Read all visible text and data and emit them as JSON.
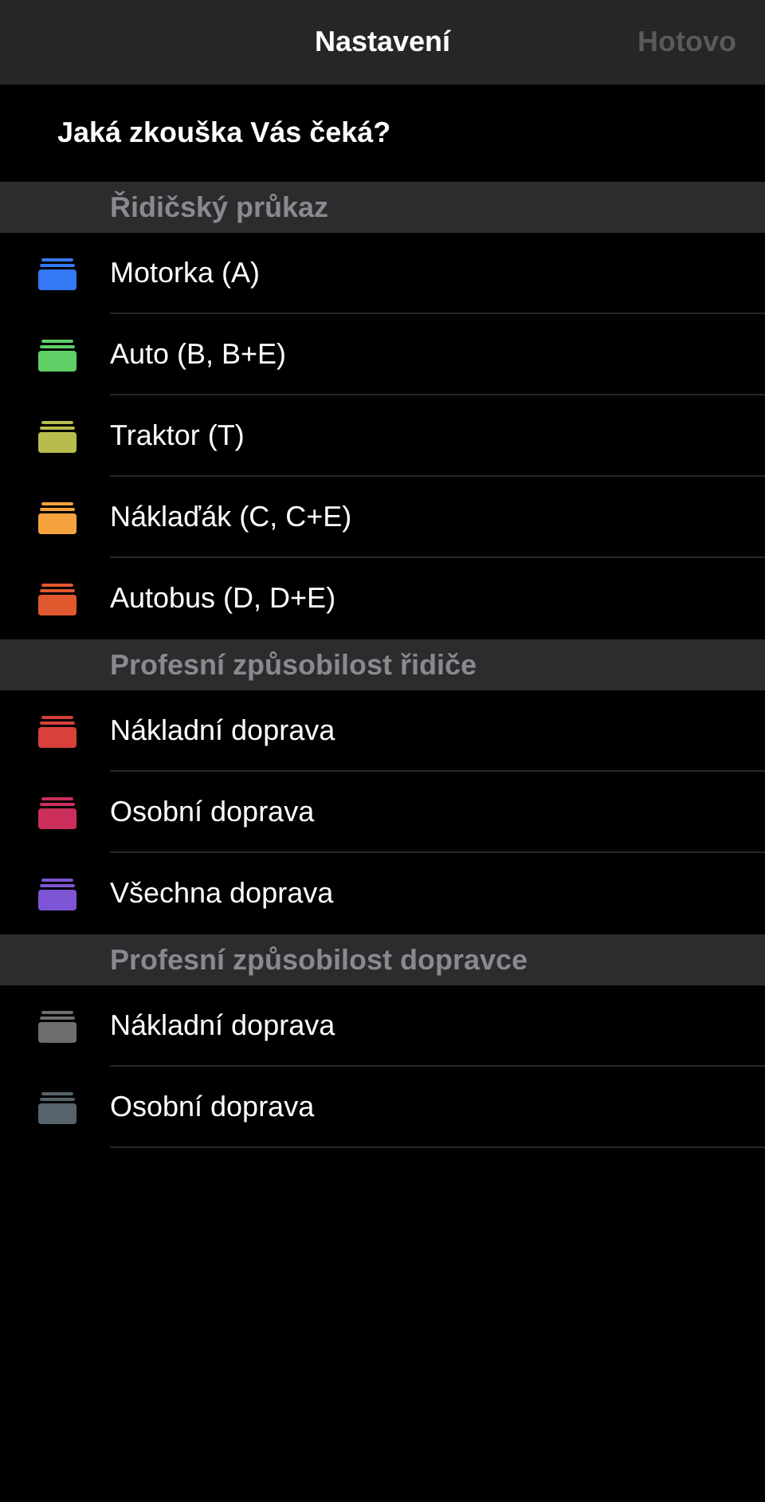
{
  "nav_bar": {
    "title": "Nastavení",
    "done_button": {
      "label": "Hotovo",
      "disabled": true
    }
  },
  "question": "Jaká zkouška Vás čeká?",
  "sections": [
    {
      "header": "Řidičský průkaz",
      "items": [
        {
          "label": "Motorka (A)",
          "color": "#3478f6"
        },
        {
          "label": "Auto (B, B+E)",
          "color": "#5fcf65"
        },
        {
          "label": "Traktor (T)",
          "color": "#b8bc4c"
        },
        {
          "label": "Náklaďák (C, C+E)",
          "color": "#f6a33e"
        },
        {
          "label": "Autobus (D, D+E)",
          "color": "#e0582e"
        }
      ]
    },
    {
      "header": "Profesní způsobilost řidiče",
      "items": [
        {
          "label": "Nákladní doprava",
          "color": "#d8403a"
        },
        {
          "label": "Osobní doprava",
          "color": "#cc2e5c"
        },
        {
          "label": "Všechna doprava",
          "color": "#7e55d4"
        }
      ]
    },
    {
      "header": "Profesní způsobilost dopravce",
      "items": [
        {
          "label": "Nákladní doprava",
          "color": "#6e6e6e"
        },
        {
          "label": "Osobní doprava",
          "color": "#56636a"
        }
      ]
    }
  ]
}
